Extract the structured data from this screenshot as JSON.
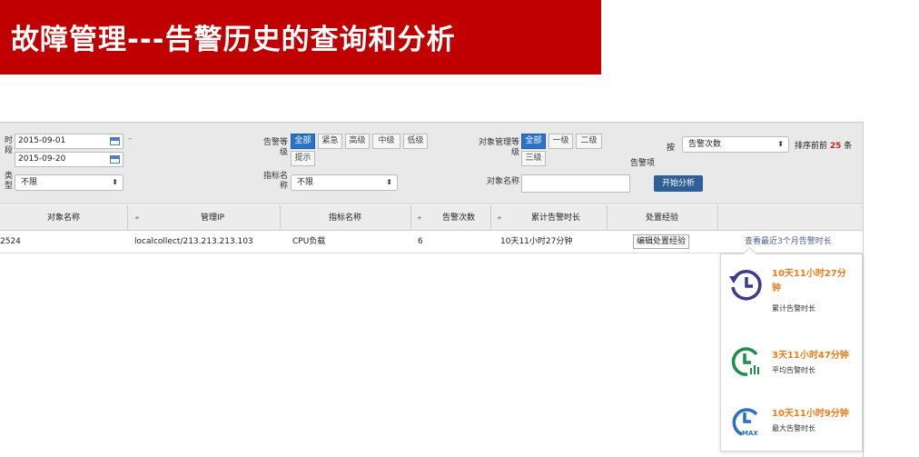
{
  "banner": {
    "title": "故障管理---告警历史的查询和分析"
  },
  "filters": {
    "time_label": "时\n段",
    "date_from": "2015-09-01",
    "date_to": "2015-09-20",
    "date_sep": "–",
    "category_label": "类\n型",
    "category_value": "不限",
    "level_label": "告警等\n级",
    "level_options": [
      "全部",
      "紧急",
      "高级",
      "中级",
      "低级",
      "提示"
    ],
    "indicator_label": "指标名\n称",
    "indicator_value": "不限",
    "obj_level_label": "对象管理等\n级",
    "obj_level_options": [
      "全部",
      "一级",
      "二级",
      "三级"
    ],
    "obj_name_label": "对象名称",
    "obj_name_value": "",
    "by_label": "按",
    "by_item_label": "告警项",
    "sort_value": "告警次数",
    "rank_prefix": "排序前前",
    "rank_count": "25",
    "rank_suffix": "条",
    "start_button": "开始分析"
  },
  "table": {
    "headers": [
      "对象名称",
      "管理IP",
      "指标名称",
      "告警次数",
      "累计告警时长",
      "处置经验"
    ],
    "sort_marker": "÷",
    "row": {
      "object": "2524",
      "ip": "localcollect/213.213.213.103",
      "indicator": "CPU负载",
      "count": "6",
      "duration": "10天11小时27分钟",
      "action": "编辑处置经验",
      "link": "查看最近3个月告警时长"
    }
  },
  "popup": {
    "stats": [
      {
        "value": "10天11小时27分钟",
        "label": "累计告警时长",
        "icon": "history-clock-icon"
      },
      {
        "value": "3天11小时47分钟",
        "label": "平均告警时长",
        "icon": "average-clock-icon"
      },
      {
        "value": "10天11小时9分钟",
        "label": "最大告警时长",
        "icon": "max-clock-icon"
      }
    ],
    "max_tag": "MAX"
  },
  "colors": {
    "banner": "#c00000",
    "accent_blue": "#2a73c7",
    "value_orange": "#f07b1a",
    "rank_red": "#d62020"
  }
}
